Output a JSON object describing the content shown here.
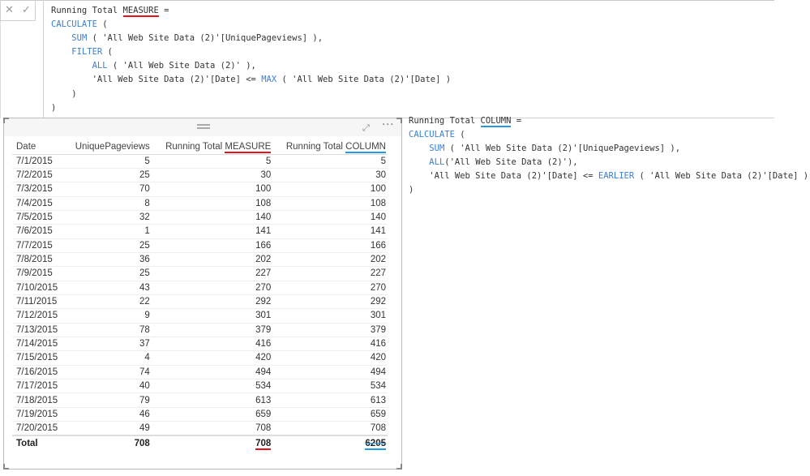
{
  "formula_bar": {
    "cancel_icon": "close-icon",
    "commit_icon": "checkmark-icon",
    "cancel_glyph": "✕",
    "commit_glyph": "✓"
  },
  "measure_code": [
    [
      {
        "t": "Running Total "
      },
      {
        "t": "MEASURE",
        "k": "ul-red"
      },
      {
        "t": " ="
      }
    ],
    [
      {
        "t": "CALCULATE",
        "k": "kw"
      },
      {
        "t": " ("
      }
    ],
    [
      {
        "t": "    "
      },
      {
        "t": "SUM",
        "k": "kw"
      },
      {
        "t": " ( 'All Web Site Data (2)'[UniquePageviews] ),"
      }
    ],
    [
      {
        "t": "    "
      },
      {
        "t": "FILTER",
        "k": "kw"
      },
      {
        "t": " ("
      }
    ],
    [
      {
        "t": "        "
      },
      {
        "t": "ALL",
        "k": "kw"
      },
      {
        "t": " ( 'All Web Site Data (2)' ),"
      }
    ],
    [
      {
        "t": "        'All Web Site Data (2)'[Date] <= "
      },
      {
        "t": "MAX",
        "k": "kw"
      },
      {
        "t": " ( 'All Web Site Data (2)'[Date] )"
      }
    ],
    [
      {
        "t": "    )"
      }
    ],
    [
      {
        "t": ")"
      }
    ]
  ],
  "column_code": [
    [
      {
        "t": "Running Total "
      },
      {
        "t": "COLUMN",
        "k": "ul-blue"
      },
      {
        "t": " ="
      }
    ],
    [
      {
        "t": "CALCULATE",
        "k": "kw"
      },
      {
        "t": " ("
      }
    ],
    [
      {
        "t": "    "
      },
      {
        "t": "SUM",
        "k": "kw"
      },
      {
        "t": " ( 'All Web Site Data (2)'[UniquePageviews] ),"
      }
    ],
    [
      {
        "t": "    "
      },
      {
        "t": "ALL",
        "k": "kw"
      },
      {
        "t": "('All Web Site Data (2)'),"
      }
    ],
    [
      {
        "t": "    'All Web Site Data (2)'[Date] <= "
      },
      {
        "t": "EARLIER",
        "k": "kw"
      },
      {
        "t": " ( 'All Web Site Data (2)'[Date] )"
      }
    ],
    [
      {
        "t": ")"
      }
    ]
  ],
  "table": {
    "headers": [
      "Date",
      "UniquePageviews",
      "Running Total MEASURE",
      "Running Total COLUMN"
    ],
    "header_prefix": "Running Total ",
    "header_measure_word": "MEASURE",
    "header_column_word": "COLUMN",
    "rows": [
      [
        "7/1/2015",
        "5",
        "5",
        "5"
      ],
      [
        "7/2/2015",
        "25",
        "30",
        "30"
      ],
      [
        "7/3/2015",
        "70",
        "100",
        "100"
      ],
      [
        "7/4/2015",
        "8",
        "108",
        "108"
      ],
      [
        "7/5/2015",
        "32",
        "140",
        "140"
      ],
      [
        "7/6/2015",
        "1",
        "141",
        "141"
      ],
      [
        "7/7/2015",
        "25",
        "166",
        "166"
      ],
      [
        "7/8/2015",
        "36",
        "202",
        "202"
      ],
      [
        "7/9/2015",
        "25",
        "227",
        "227"
      ],
      [
        "7/10/2015",
        "43",
        "270",
        "270"
      ],
      [
        "7/11/2015",
        "22",
        "292",
        "292"
      ],
      [
        "7/12/2015",
        "9",
        "301",
        "301"
      ],
      [
        "7/13/2015",
        "78",
        "379",
        "379"
      ],
      [
        "7/14/2015",
        "37",
        "416",
        "416"
      ],
      [
        "7/15/2015",
        "4",
        "420",
        "420"
      ],
      [
        "7/16/2015",
        "74",
        "494",
        "494"
      ],
      [
        "7/17/2015",
        "40",
        "534",
        "534"
      ],
      [
        "7/18/2015",
        "79",
        "613",
        "613"
      ],
      [
        "7/19/2015",
        "46",
        "659",
        "659"
      ],
      [
        "7/20/2015",
        "49",
        "708",
        "708"
      ]
    ],
    "total": [
      "Total",
      "708",
      "708",
      "6205"
    ]
  },
  "colors": {
    "measure_underline": "#e8101b",
    "column_underline": "#1e9be4",
    "keyword": "#3a7fd0"
  }
}
